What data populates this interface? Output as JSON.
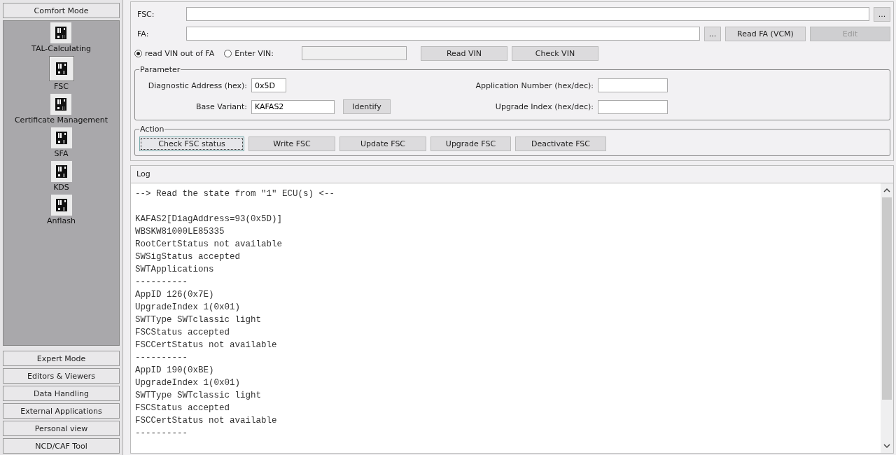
{
  "sidebar": {
    "mode_button": "Comfort Mode",
    "items": [
      {
        "label": "TAL-Calculating",
        "selected": false
      },
      {
        "label": "FSC",
        "selected": true
      },
      {
        "label": "Certificate Management",
        "selected": false
      },
      {
        "label": "SFA",
        "selected": false
      },
      {
        "label": "KDS",
        "selected": false
      },
      {
        "label": "Anflash",
        "selected": false
      }
    ],
    "mode_buttons": [
      "Expert Mode",
      "Editors & Viewers",
      "Data Handling",
      "External Applications",
      "Personal view",
      "NCD/CAF Tool"
    ]
  },
  "fsc": {
    "label": "FSC:",
    "browse_button": "..."
  },
  "fa": {
    "label": "FA:",
    "browse_button": "...",
    "read_button": "Read FA (VCM)",
    "edit_button": {
      "label": "Edit",
      "disabled": true
    }
  },
  "vin": {
    "options": [
      {
        "label": "read VIN out of FA",
        "selected": true
      },
      {
        "label": "Enter VIN:",
        "selected": false
      }
    ],
    "read_button": "Read VIN",
    "check_button": "Check VIN"
  },
  "parameter": {
    "title": "Parameter",
    "diag_label": "Diagnostic Address (hex):",
    "diag_value": "0x5D",
    "variant_label": "Base Variant:",
    "variant_value": "KAFAS2",
    "identify_button": "Identify",
    "app_label": "Application Number (hex/dec):",
    "upgrade_label": "Upgrade Index (hex/dec):"
  },
  "action": {
    "title": "Action",
    "buttons": [
      {
        "label": "Check FSC status",
        "focused": true
      },
      {
        "label": "Write FSC",
        "focused": false
      },
      {
        "label": "Update FSC",
        "focused": false
      },
      {
        "label": "Upgrade FSC",
        "focused": false
      },
      {
        "label": "Deactivate FSC",
        "focused": false
      }
    ]
  },
  "log": {
    "title": "Log",
    "heading_line": "--> Read the state from \"1\" ECU(s) <--",
    "lines": [
      "KAFAS2[DiagAddress=93(0x5D)]",
      "WBSKW81000LE85335",
      "RootCertStatus not available",
      "SWSigStatus accepted",
      "SWTApplications",
      "----------",
      "AppID 126(0x7E)",
      "UpgradeIndex 1(0x01)",
      "SWTType SWTclassic light",
      "FSCStatus accepted",
      "FSCCertStatus not available",
      "----------",
      "AppID 190(0xBE)",
      "UpgradeIndex 1(0x01)",
      "SWTType SWTclassic light",
      "FSCStatus accepted",
      "FSCCertStatus not available",
      "----------"
    ]
  }
}
